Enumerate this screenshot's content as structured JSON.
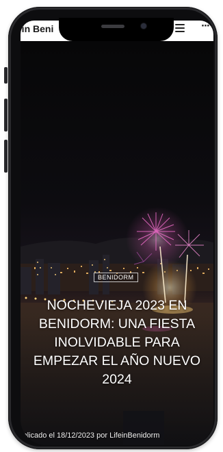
{
  "site": {
    "title": "e in Beni",
    "menu_icon": "hamburger-menu-icon",
    "more_icon": "more-dots-icon",
    "more_text": "···"
  },
  "post": {
    "category": "BENIDORM",
    "headline_lines": [
      "NOCHEVIEJA 2023 EN",
      "BENIDORM: UNA FIESTA",
      "INOLVIDABLE PARA",
      "EMPEZAR EL AÑO NUEVO",
      "2024"
    ],
    "byline_prefix": "Publicado el ",
    "date": "18/12/2023",
    "byline_mid": " por ",
    "author": "LifeinBenidorm"
  },
  "colors": {
    "text_on_image": "#ffffff",
    "firework_pink": "#e25ab8",
    "phone_frame": "#2a2a2d"
  }
}
